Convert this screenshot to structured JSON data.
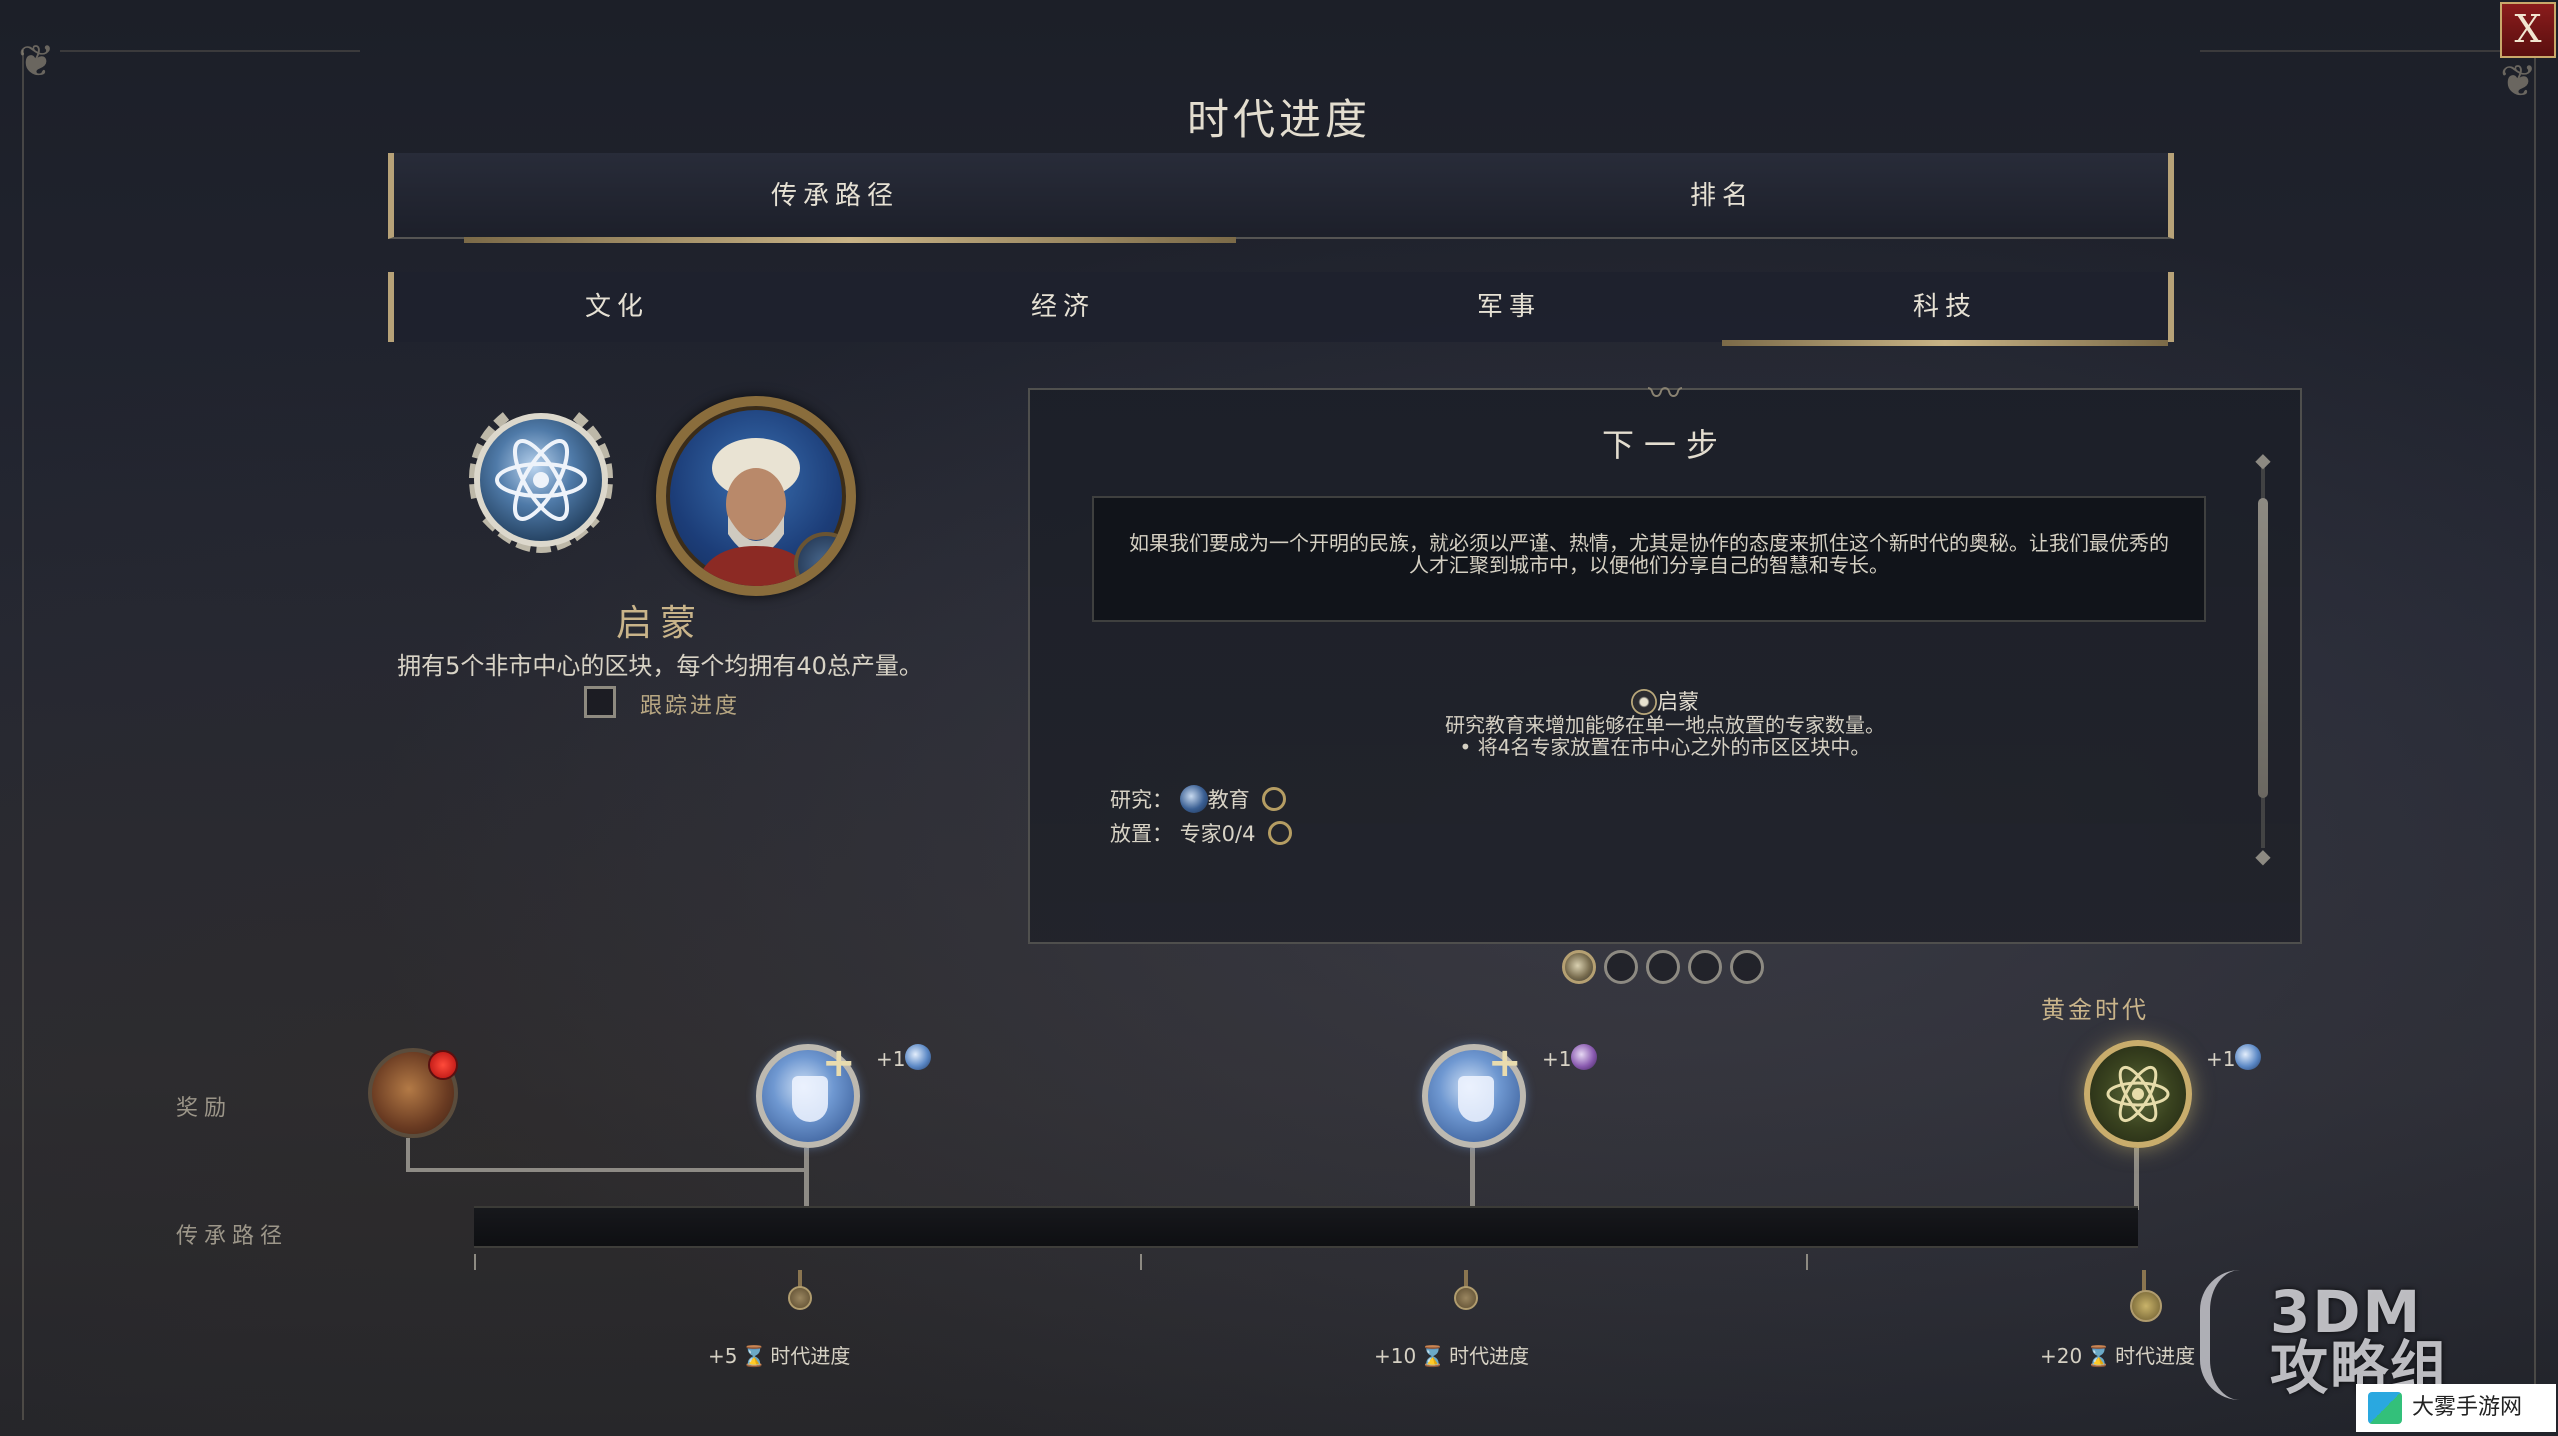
{
  "window": {
    "title": "时代进度",
    "close_label": "X"
  },
  "tabs": [
    {
      "label": "传承路径",
      "active": true
    },
    {
      "label": "排名",
      "active": false
    }
  ],
  "subtabs": [
    {
      "label": "文化",
      "active": false
    },
    {
      "label": "经济",
      "active": false
    },
    {
      "label": "军事",
      "active": false
    },
    {
      "label": "科技",
      "active": true
    }
  ],
  "current_item": {
    "name": "启蒙",
    "description": "拥有5个非市中心的区块，每个均拥有40总产量。",
    "track_label": "跟踪进度",
    "track_checked": false,
    "medal_icon": "atom-laurel-icon",
    "portrait_icon": "advisor-portrait"
  },
  "next_step": {
    "title": "下一步",
    "quote": "如果我们要成为一个开明的民族，就必须以严谨、热情，尤其是协作的态度来抓住这个新时代的奥秘。让我们最优秀的人才汇聚到城市中，以便他们分享自己的智慧和专长。",
    "objective_title": "启蒙",
    "objective_desc_1": "研究教育来增加能够在单一地点放置的专家数量。",
    "objective_desc_2": "• 将4名专家放置在市中心之外的市区区块中。",
    "requirements": [
      {
        "label": "研究：",
        "value": "教育"
      },
      {
        "label": "放置：",
        "value": "专家0/4"
      }
    ]
  },
  "pager": {
    "count": 5,
    "active_index": 0
  },
  "timeline": {
    "row_rewards": "奖励",
    "row_path": "传承路径",
    "golden_age_label": "黄金时代",
    "rewards": [
      {
        "badge": "+1",
        "icon": "science-flask-icon",
        "color": "#5c89c6"
      },
      {
        "badge": "+1",
        "icon": "science-flask-icon",
        "color": "#8a5bb0"
      },
      {
        "badge": "+1",
        "icon": "atom-golden-icon",
        "color": "#c9ad6c"
      }
    ],
    "milestones": [
      {
        "amount": "+5",
        "label": "时代进度"
      },
      {
        "amount": "+10",
        "label": "时代进度"
      },
      {
        "amount": "+20",
        "label": "时代进度"
      }
    ]
  },
  "watermarks": {
    "main_line1": "3DM",
    "main_line2": "攻略组",
    "corner": "大雾手游网"
  }
}
